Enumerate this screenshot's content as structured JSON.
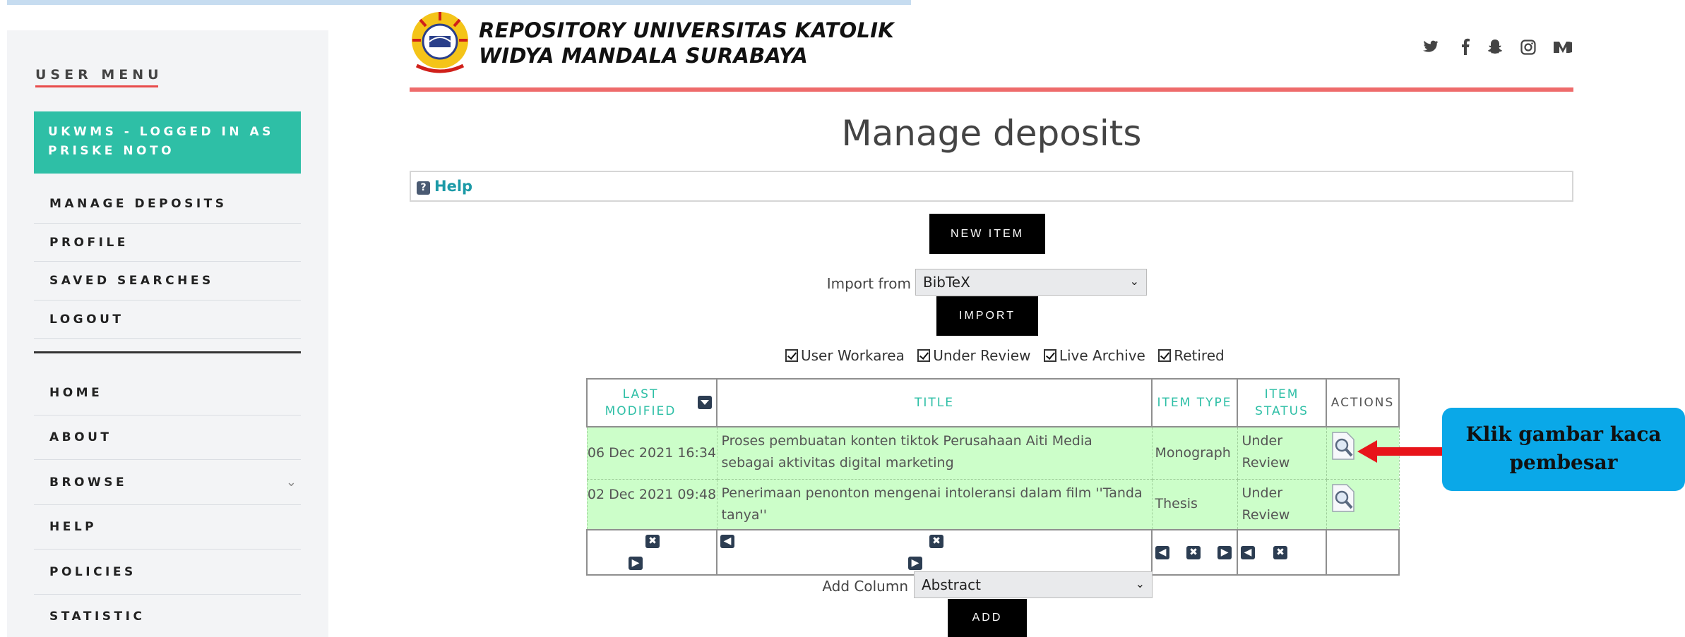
{
  "sidebar": {
    "heading": "USER MENU",
    "logged_in": "UKWMS - LOGGED IN AS PRISKE NOTO",
    "user_items": [
      "MANAGE DEPOSITS",
      "PROFILE",
      "SAVED SEARCHES",
      "LOGOUT"
    ],
    "nav_items": [
      "HOME",
      "ABOUT",
      "BROWSE",
      "HELP",
      "POLICIES",
      "STATISTIC"
    ]
  },
  "header": {
    "title_line1": "REPOSITORY UNIVERSITAS KATOLIK",
    "title_line2": "WIDYA MANDALA SURABAYA",
    "social_icons": [
      "twitter-icon",
      "facebook-icon",
      "snapchat-icon",
      "instagram-icon",
      "medium-icon"
    ],
    "accent_color": "#ee6b6b"
  },
  "main": {
    "page_title": "Manage deposits",
    "help_label": "Help",
    "new_item_label": "NEW ITEM",
    "import_label": "Import from",
    "import_value": "BibTeX",
    "import_button": "IMPORT",
    "filters": [
      "User Workarea",
      "Under Review",
      "Live Archive",
      "Retired"
    ],
    "table": {
      "headers": {
        "last_modified": "LAST MODIFIED",
        "title": "TITLE",
        "item_type": "ITEM TYPE",
        "item_status": "ITEM STATUS",
        "actions": "ACTIONS"
      },
      "rows": [
        {
          "last_modified": "06 Dec 2021 16:34",
          "title": "Proses pembuatan konten tiktok Perusahaan Aiti Media sebagai aktivitas digital marketing",
          "item_type": "Monograph",
          "item_status": "Under Review"
        },
        {
          "last_modified": "02 Dec 2021 09:48",
          "title": "Penerimaan penonton mengenai intoleransi dalam film ''Tanda tanya''",
          "item_type": "Thesis",
          "item_status": "Under Review"
        }
      ]
    },
    "add_column_label": "Add Column",
    "add_column_value": "Abstract",
    "add_button": "ADD"
  },
  "annotation": {
    "text": "Klik gambar kaca pembesar",
    "box_color": "#0aa8e8",
    "arrow_color": "#e8141a"
  }
}
